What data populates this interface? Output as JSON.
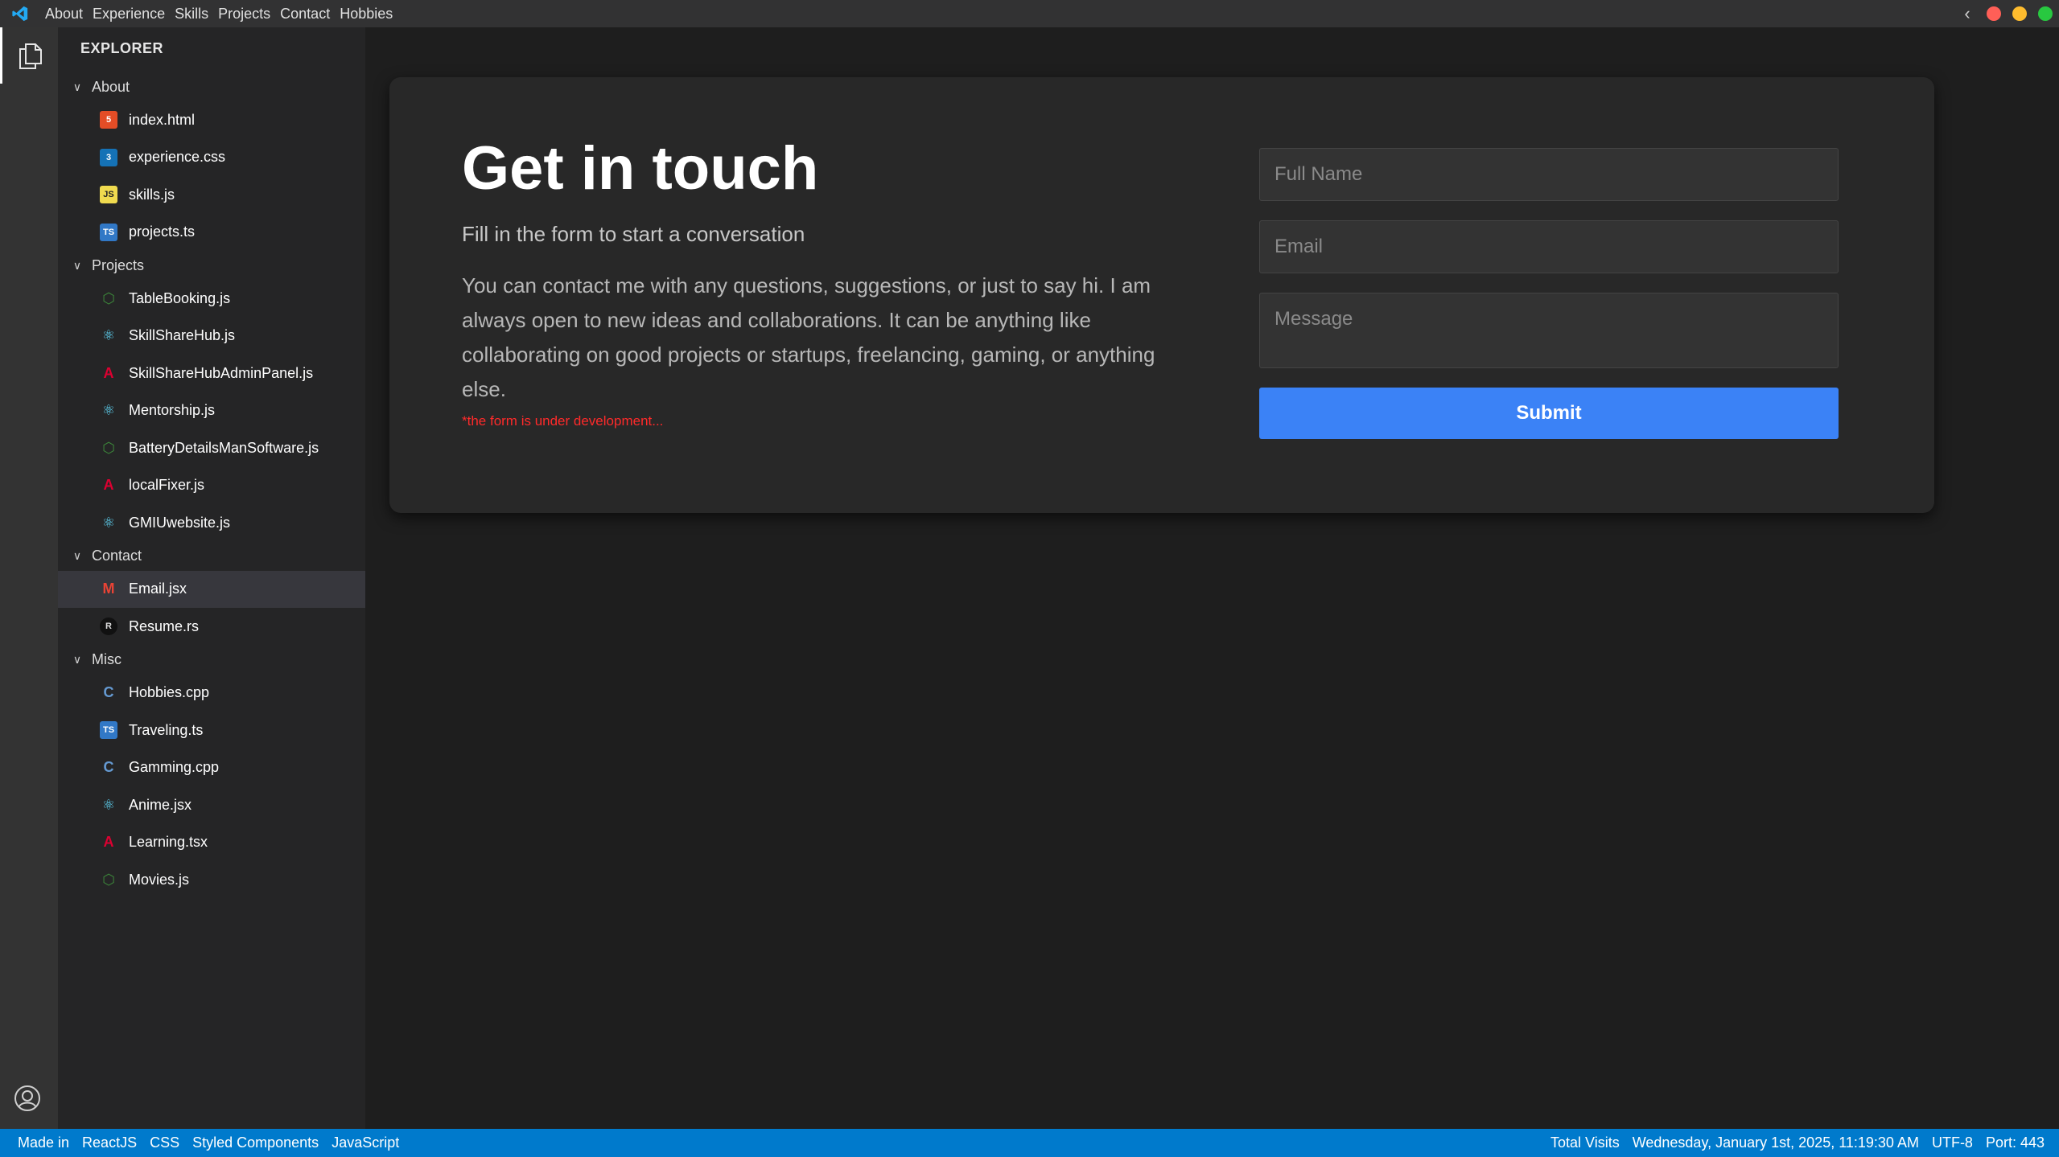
{
  "menu": [
    "About",
    "Experience",
    "Skills",
    "Projects",
    "Contact",
    "Hobbies"
  ],
  "window_controls": {
    "close_color": "#ff5f57",
    "minimize_color": "#febc2e",
    "maximize_color": "#28c840"
  },
  "explorer": {
    "title": "EXPLORER",
    "sections": [
      {
        "label": "About",
        "files": [
          {
            "name": "index.html",
            "icon": "html5-icon",
            "color": "#e44d26",
            "glyph": "5"
          },
          {
            "name": "experience.css",
            "icon": "css3-icon",
            "color": "#1572b6",
            "glyph": "3"
          },
          {
            "name": "skills.js",
            "icon": "javascript-icon",
            "color": "#f0db4f",
            "glyph": "JS"
          },
          {
            "name": "projects.ts",
            "icon": "typescript-icon",
            "color": "#3178c6",
            "glyph": "TS"
          }
        ]
      },
      {
        "label": "Projects",
        "files": [
          {
            "name": "TableBooking.js",
            "icon": "nodejs-icon",
            "color": "#3c873a",
            "glyph": "⬡"
          },
          {
            "name": "SkillShareHub.js",
            "icon": "react-icon",
            "color": "#61dafb",
            "glyph": "⚛"
          },
          {
            "name": "SkillShareHubAdminPanel.js",
            "icon": "angular-icon",
            "color": "#dd0031",
            "glyph": "A"
          },
          {
            "name": "Mentorship.js",
            "icon": "react-icon",
            "color": "#61dafb",
            "glyph": "⚛"
          },
          {
            "name": "BatteryDetailsManSoftware.js",
            "icon": "nodejs-icon",
            "color": "#3c873a",
            "glyph": "⬡"
          },
          {
            "name": "localFixer.js",
            "icon": "angular-icon",
            "color": "#dd0031",
            "glyph": "A"
          },
          {
            "name": "GMIUwebsite.js",
            "icon": "react-icon",
            "color": "#61dafb",
            "glyph": "⚛"
          }
        ]
      },
      {
        "label": "Contact",
        "files": [
          {
            "name": "Email.jsx",
            "icon": "gmail-icon",
            "color": "#ea4335",
            "glyph": "M",
            "active": true
          },
          {
            "name": "Resume.rs",
            "icon": "rust-icon",
            "color": "#000000",
            "glyph": "R"
          }
        ]
      },
      {
        "label": "Misc",
        "files": [
          {
            "name": "Hobbies.cpp",
            "icon": "cpp-icon",
            "color": "#659ad2",
            "glyph": "C"
          },
          {
            "name": "Traveling.ts",
            "icon": "typescript-icon",
            "color": "#3178c6",
            "glyph": "TS"
          },
          {
            "name": "Gamming.cpp",
            "icon": "cpp-icon",
            "color": "#659ad2",
            "glyph": "C"
          },
          {
            "name": "Anime.jsx",
            "icon": "react-icon",
            "color": "#61dafb",
            "glyph": "⚛"
          },
          {
            "name": "Learning.tsx",
            "icon": "angular-icon",
            "color": "#dd0031",
            "glyph": "A"
          },
          {
            "name": "Movies.js",
            "icon": "nodejs-icon",
            "color": "#3c873a",
            "glyph": "⬡"
          }
        ]
      }
    ]
  },
  "contact": {
    "heading": "Get in touch",
    "subheading": "Fill in the form to start a conversation",
    "description": "You can contact me with any questions, suggestions, or just to say hi. I am always open to new ideas and collaborations. It can be anything like collaborating on good projects or startups, freelancing, gaming, or anything else.",
    "warning": "*the form is under development...",
    "fullname_placeholder": "Full Name",
    "email_placeholder": "Email",
    "message_placeholder": "Message",
    "submit_label": "Submit"
  },
  "statusbar": {
    "left": [
      "Made in",
      "ReactJS",
      "CSS",
      "Styled Components",
      "JavaScript"
    ],
    "right": [
      "Total Visits",
      "Wednesday, January 1st, 2025, 11:19:30 AM",
      "UTF-8",
      "Port: 443"
    ]
  },
  "colors": {
    "accent": "#007acc",
    "submit": "#3b82f6",
    "warning": "#ff2a2a"
  }
}
